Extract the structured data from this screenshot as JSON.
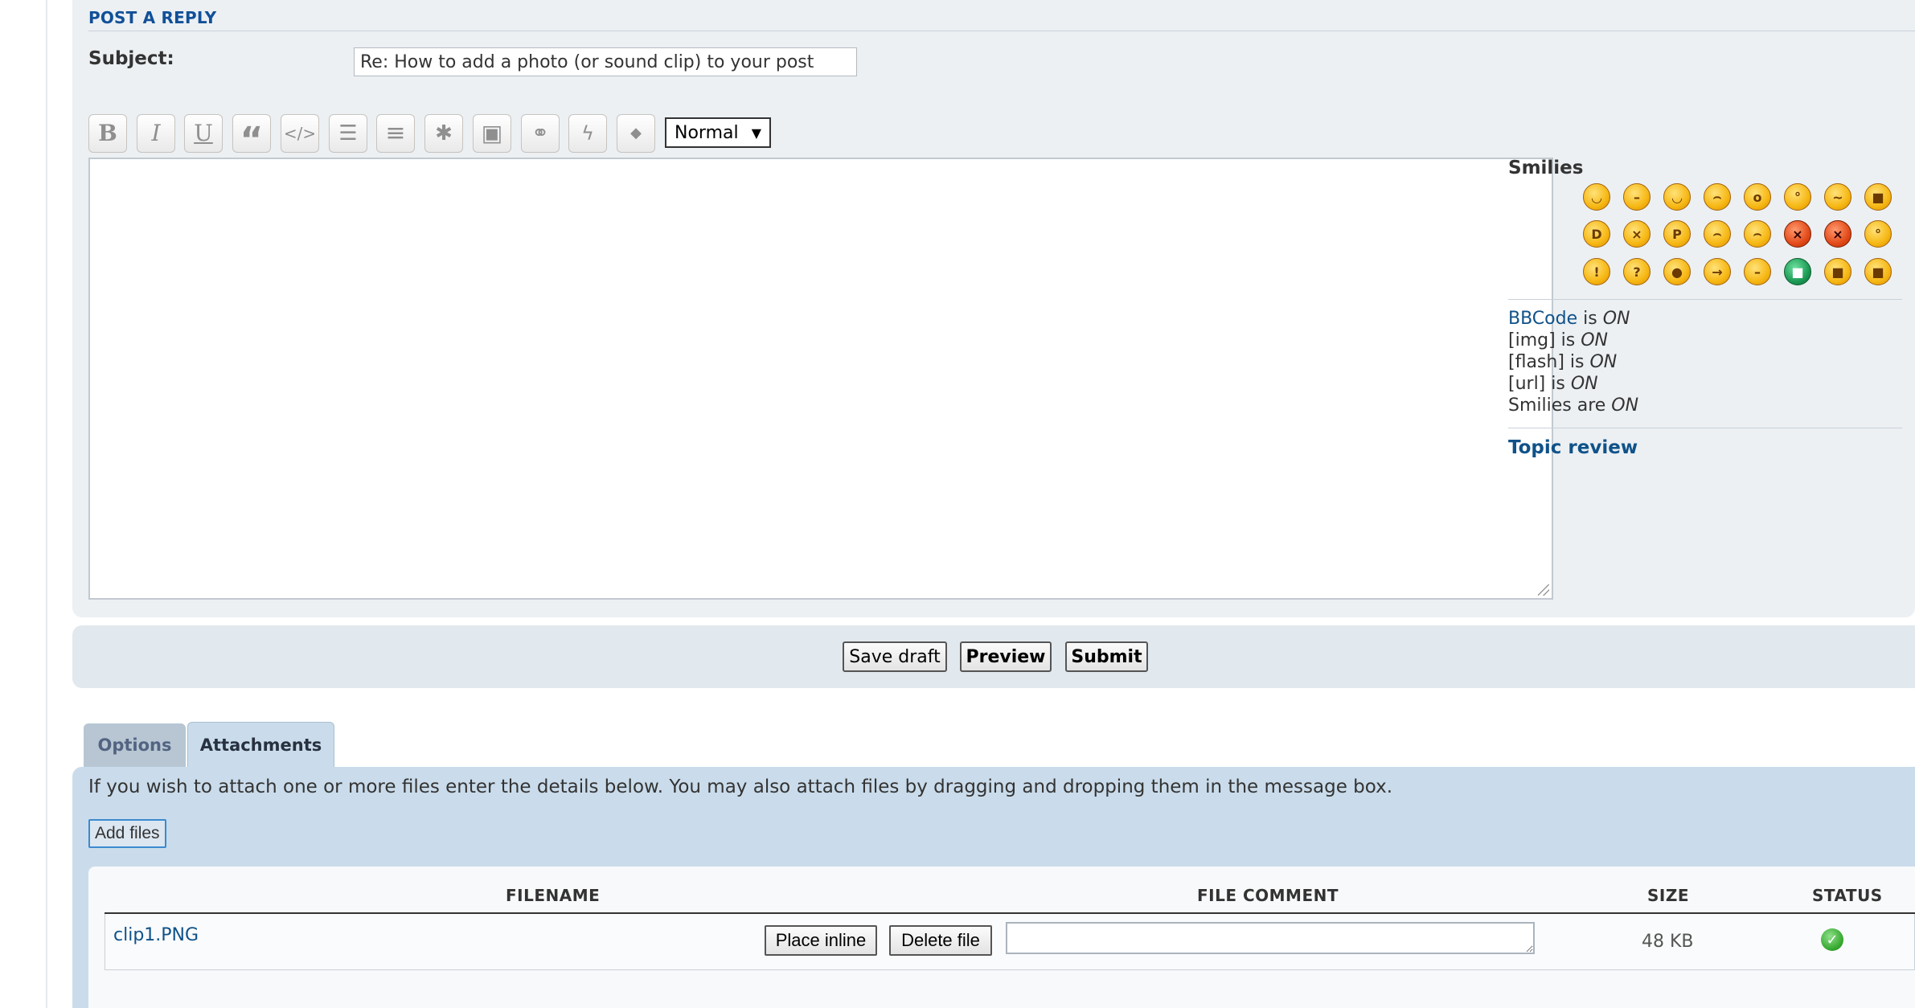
{
  "post_reply": {
    "title": "POST A REPLY",
    "subject_label": "Subject:",
    "subject_value": "Re: How to add a photo (or sound clip) to your post"
  },
  "toolbar": {
    "buttons": [
      {
        "name": "bold",
        "glyph": "B",
        "icon": "bold-icon"
      },
      {
        "name": "italic",
        "glyph": "I",
        "icon": "italic-icon"
      },
      {
        "name": "underline",
        "glyph": "U",
        "icon": "underline-icon"
      },
      {
        "name": "quote",
        "glyph": "“",
        "icon": "quote-icon"
      },
      {
        "name": "code",
        "glyph": "</>",
        "icon": "code-icon"
      },
      {
        "name": "list",
        "glyph": "☰",
        "icon": "list-icon"
      },
      {
        "name": "ordered-list",
        "glyph": "≡",
        "icon": "ordered-list-icon"
      },
      {
        "name": "list-item",
        "glyph": "✱",
        "icon": "asterisk-icon"
      },
      {
        "name": "image",
        "glyph": "▣",
        "icon": "image-icon"
      },
      {
        "name": "link",
        "glyph": "⚭",
        "icon": "link-icon"
      },
      {
        "name": "flash",
        "glyph": "ϟ",
        "icon": "flash-icon"
      },
      {
        "name": "color",
        "glyph": "◆",
        "icon": "droplet-icon"
      }
    ],
    "font_size": "Normal"
  },
  "smilies": {
    "title": "Smilies",
    "rows": [
      [
        "◡",
        "–",
        "◡",
        "⌢",
        "o",
        "°",
        "~",
        "■"
      ],
      [
        "D",
        "×",
        "P",
        "⌢",
        "⌢",
        "×",
        "×",
        "°"
      ],
      [
        "!",
        "?",
        "●",
        "→",
        "–",
        "■",
        "■",
        "■"
      ]
    ]
  },
  "bbcode_status": {
    "bbcode_link": "BBCode",
    "bbcode_text": " is ",
    "bbcode_state": "ON",
    "img_text": "[img] is ",
    "img_state": "ON",
    "flash_text": "[flash] is ",
    "flash_state": "ON",
    "url_text": "[url] is ",
    "url_state": "ON",
    "smilies_text": "Smilies are ",
    "smilies_state": "ON"
  },
  "topic_review": "Topic review",
  "submit_bar": {
    "save_draft": "Save draft",
    "preview": "Preview",
    "submit": "Submit"
  },
  "tabs": [
    {
      "label": "Options",
      "active": false
    },
    {
      "label": "Attachments",
      "active": true
    }
  ],
  "attachments": {
    "help_text": "If you wish to attach one or more files enter the details below. You may also attach files by dragging and dropping them in the message box.",
    "add_files": "Add files",
    "columns": {
      "filename": "FILENAME",
      "file_comment": "FILE COMMENT",
      "size": "SIZE",
      "status": "STATUS"
    },
    "files": [
      {
        "filename": "clip1.PNG",
        "place_inline": "Place inline",
        "delete_file": "Delete file",
        "comment": "",
        "size": "48 KB",
        "status": "ok"
      }
    ]
  }
}
